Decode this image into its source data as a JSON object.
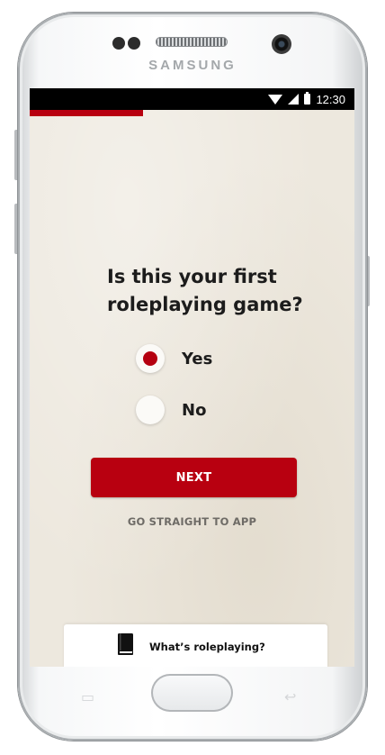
{
  "device": {
    "brand": "SAMSUNG"
  },
  "status_bar": {
    "time": "12:30",
    "icons": [
      "wifi-icon",
      "signal-icon",
      "battery-icon"
    ]
  },
  "progress": {
    "fraction": 0.35,
    "color": "#b80010"
  },
  "question": {
    "text": "Is this your first roleplaying game?"
  },
  "options": [
    {
      "label": "Yes",
      "selected": true
    },
    {
      "label": "No",
      "selected": false
    }
  ],
  "actions": {
    "next_label": "NEXT",
    "skip_label": "GO STRAIGHT TO APP"
  },
  "help": {
    "label": "What’s roleplaying?",
    "icon": "book-icon"
  },
  "colors": {
    "accent": "#b80010",
    "background": "#ede8de",
    "text": "#1c1c1c"
  }
}
